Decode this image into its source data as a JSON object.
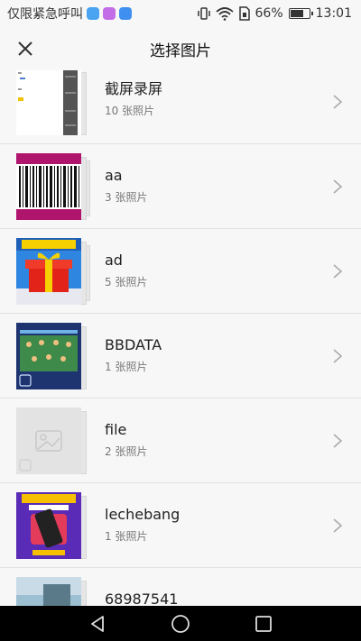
{
  "status_bar": {
    "carrier_text": "仅限紧急呼叫",
    "battery_percent_text": "66%",
    "battery_level": 0.66,
    "time": "13:01",
    "icons": [
      "vibrate-icon",
      "wifi-icon",
      "sim-icon",
      "battery-icon"
    ],
    "app_badges": [
      {
        "name": "chat-badge",
        "color": "#4aa3f0"
      },
      {
        "name": "gallery-badge",
        "color": "#c36ee6"
      },
      {
        "name": "heart-badge",
        "color": "#3f8ff0"
      }
    ]
  },
  "header": {
    "title": "选择图片",
    "close_icon": "close-icon"
  },
  "albums": [
    {
      "name": "截屏录屏",
      "count": "10 张照片",
      "thumb": "screenshot"
    },
    {
      "name": "aa",
      "count": "3 张照片",
      "thumb": "barcode"
    },
    {
      "name": "ad",
      "count": "5 张照片",
      "thumb": "gift"
    },
    {
      "name": "BBDATA",
      "count": "1 张照片",
      "thumb": "team"
    },
    {
      "name": "file",
      "count": "2 张照片",
      "thumb": "placeholder"
    },
    {
      "name": "lechebang",
      "count": "1 张照片",
      "thumb": "promo"
    },
    {
      "name": "68987541",
      "count": "",
      "thumb": "photo"
    }
  ],
  "nav_bar": {
    "back_icon": "back-triangle-icon",
    "home_icon": "home-circle-icon",
    "recent_icon": "recent-square-icon"
  },
  "colors": {
    "background": "#f7f7f7",
    "divider": "#e2e2e2",
    "nav_bar": "#000000"
  }
}
